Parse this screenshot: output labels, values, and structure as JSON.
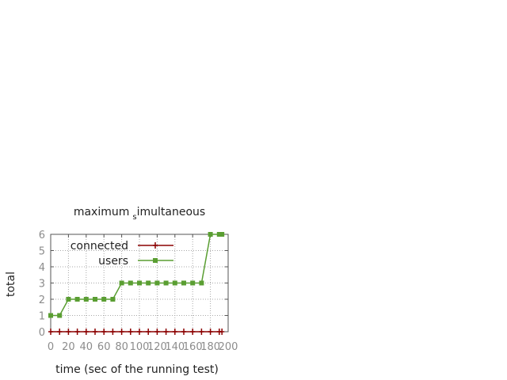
{
  "chart_data": {
    "type": "line",
    "title_main": "maximum",
    "title_sub": "s",
    "title_rest": "imultaneous",
    "xlabel": "time (sec of the running test)",
    "ylabel": "total",
    "xlim": [
      0,
      200
    ],
    "ylim": [
      0,
      6
    ],
    "xticks": [
      "0",
      "20",
      "40",
      "60",
      "80",
      "100",
      "120",
      "140",
      "160",
      "180",
      "200"
    ],
    "yticks": [
      "0",
      "1",
      "2",
      "3",
      "4",
      "5",
      "6"
    ],
    "grid": true,
    "legend_position": "top-left",
    "series": [
      {
        "name": "connected",
        "color": "#8b0000",
        "marker": "plus",
        "x": [
          0,
          10,
          20,
          30,
          40,
          50,
          60,
          70,
          80,
          90,
          100,
          110,
          120,
          130,
          140,
          150,
          160,
          170,
          180,
          190,
          193
        ],
        "y": [
          0,
          0,
          0,
          0,
          0,
          0,
          0,
          0,
          0,
          0,
          0,
          0,
          0,
          0,
          0,
          0,
          0,
          0,
          0,
          0,
          0
        ]
      },
      {
        "name": "users",
        "color": "#5a9e32",
        "marker": "filled-square",
        "x": [
          0,
          10,
          20,
          30,
          40,
          50,
          60,
          70,
          80,
          90,
          100,
          110,
          120,
          130,
          140,
          150,
          160,
          170,
          180,
          190,
          193
        ],
        "y": [
          1,
          1,
          2,
          2,
          2,
          2,
          2,
          2,
          3,
          3,
          3,
          3,
          3,
          3,
          3,
          3,
          3,
          3,
          6,
          6,
          6
        ]
      }
    ]
  }
}
